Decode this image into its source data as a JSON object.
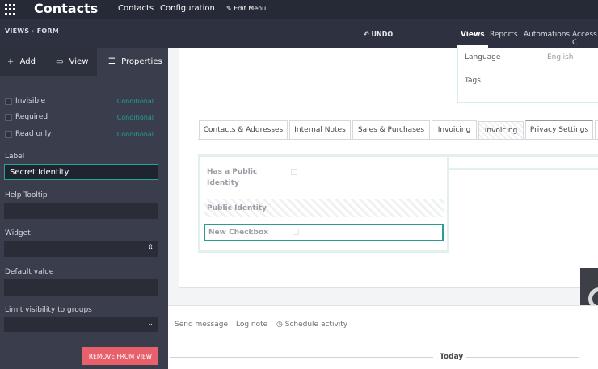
{
  "topbar": {
    "brand": "Contacts",
    "menu": [
      "Contacts",
      "Configuration"
    ],
    "edit_menu": "Edit Menu"
  },
  "subbar": {
    "breadcrumb": [
      "VIEWS",
      "FORM"
    ],
    "undo": "UNDO",
    "tabs": [
      "Views",
      "Reports",
      "Automations",
      "Access C"
    ]
  },
  "sidebar": {
    "tabs": {
      "add": "Add",
      "view": "View",
      "properties": "Properties"
    },
    "checkboxes": [
      {
        "label": "Invisible",
        "cond": "Conditional"
      },
      {
        "label": "Required",
        "cond": "Conditional"
      },
      {
        "label": "Read only",
        "cond": "Conditional"
      }
    ],
    "label_title": "Label",
    "label_value": "Secret Identity",
    "help_title": "Help Tooltip",
    "widget_title": "Widget",
    "default_title": "Default value",
    "groups_title": "Limit visibility to groups",
    "remove_button": "REMOVE FROM VIEW"
  },
  "form": {
    "language_label": "Language",
    "language_value": "English",
    "tags_label": "Tags",
    "notebook_tabs": [
      "Contacts & Addresses",
      "Internal Notes",
      "Sales & Purchases",
      "Invoicing",
      "Invoicing",
      "Privacy Settings"
    ],
    "privacy_fields": [
      "Has a Public Identity",
      "Public Identity",
      "New Checkbox"
    ]
  },
  "chatter": {
    "send_message": "Send message",
    "log_note": "Log note",
    "schedule": "Schedule activity",
    "today": "Today"
  }
}
